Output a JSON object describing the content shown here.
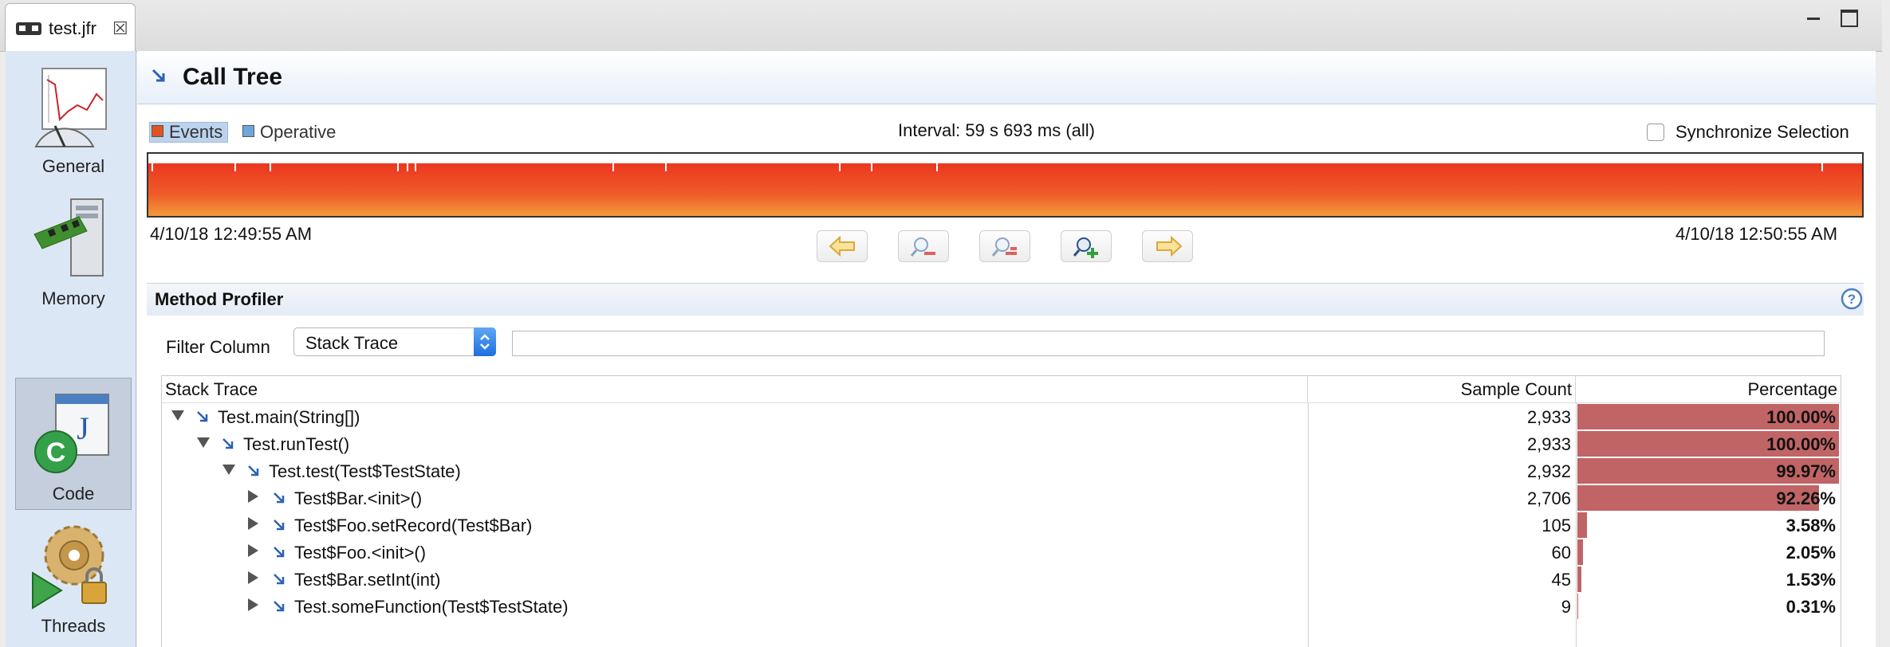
{
  "editor_tab": {
    "label": "test.jfr",
    "icon": "jfr-file-icon",
    "close_icon": "close-icon"
  },
  "window_controls": {
    "minimize_icon": "minimize-icon",
    "maximize_icon": "maximize-icon"
  },
  "sidebar": {
    "items": [
      {
        "label": "General",
        "icon": "gauge-chart-icon",
        "selected": false
      },
      {
        "label": "Memory",
        "icon": "memory-chip-icon",
        "selected": false
      },
      {
        "label": "Code",
        "icon": "java-code-icon",
        "selected": true
      },
      {
        "label": "Threads",
        "icon": "threads-gears-icon",
        "selected": false
      }
    ]
  },
  "header": {
    "title": "Call Tree",
    "icon": "call-tree-arrow-icon"
  },
  "timeline": {
    "legend": {
      "events": "Events",
      "operative": "Operative"
    },
    "interval": "Interval: 59 s 693 ms (all)",
    "sync_label": "Synchronize Selection",
    "sync_checked": false,
    "start_time": "4/10/18 12:49:55 AM",
    "end_time": "4/10/18 12:50:55 AM",
    "bar_color": "#ee4b24",
    "buttons": [
      "scroll-left-icon",
      "zoom-out-icon",
      "zoom-out-selection-icon",
      "zoom-in-icon",
      "scroll-right-icon"
    ]
  },
  "profiler": {
    "title": "Method Profiler",
    "help_icon": "help-icon",
    "filter_label": "Filter Column",
    "filter_value": "Stack Trace",
    "filter_text": "",
    "columns": {
      "trace": "Stack Trace",
      "count": "Sample Count",
      "percentage": "Percentage"
    },
    "bar_color": "#c06466",
    "rows": [
      {
        "name": "Test.main(String[])",
        "depth": 0,
        "state": "expanded",
        "count": "2,933",
        "pct": "100.00%",
        "fraction": 1.0
      },
      {
        "name": "Test.runTest()",
        "depth": 1,
        "state": "expanded",
        "count": "2,933",
        "pct": "100.00%",
        "fraction": 1.0
      },
      {
        "name": "Test.test(Test$TestState)",
        "depth": 2,
        "state": "expanded",
        "count": "2,932",
        "pct": "99.97%",
        "fraction": 0.9997
      },
      {
        "name": "Test$Bar.<init>()",
        "depth": 3,
        "state": "collapsed",
        "count": "2,706",
        "pct": "92.26%",
        "fraction": 0.9226
      },
      {
        "name": "Test$Foo.setRecord(Test$Bar)",
        "depth": 3,
        "state": "collapsed",
        "count": "105",
        "pct": "3.58%",
        "fraction": 0.0358
      },
      {
        "name": "Test$Foo.<init>()",
        "depth": 3,
        "state": "collapsed",
        "count": "60",
        "pct": "2.05%",
        "fraction": 0.0205
      },
      {
        "name": "Test$Bar.setInt(int)",
        "depth": 3,
        "state": "collapsed",
        "count": "45",
        "pct": "1.53%",
        "fraction": 0.0153
      },
      {
        "name": "Test.someFunction(Test$TestState)",
        "depth": 3,
        "state": "collapsed",
        "count": "9",
        "pct": "0.31%",
        "fraction": 0.0031
      }
    ]
  }
}
